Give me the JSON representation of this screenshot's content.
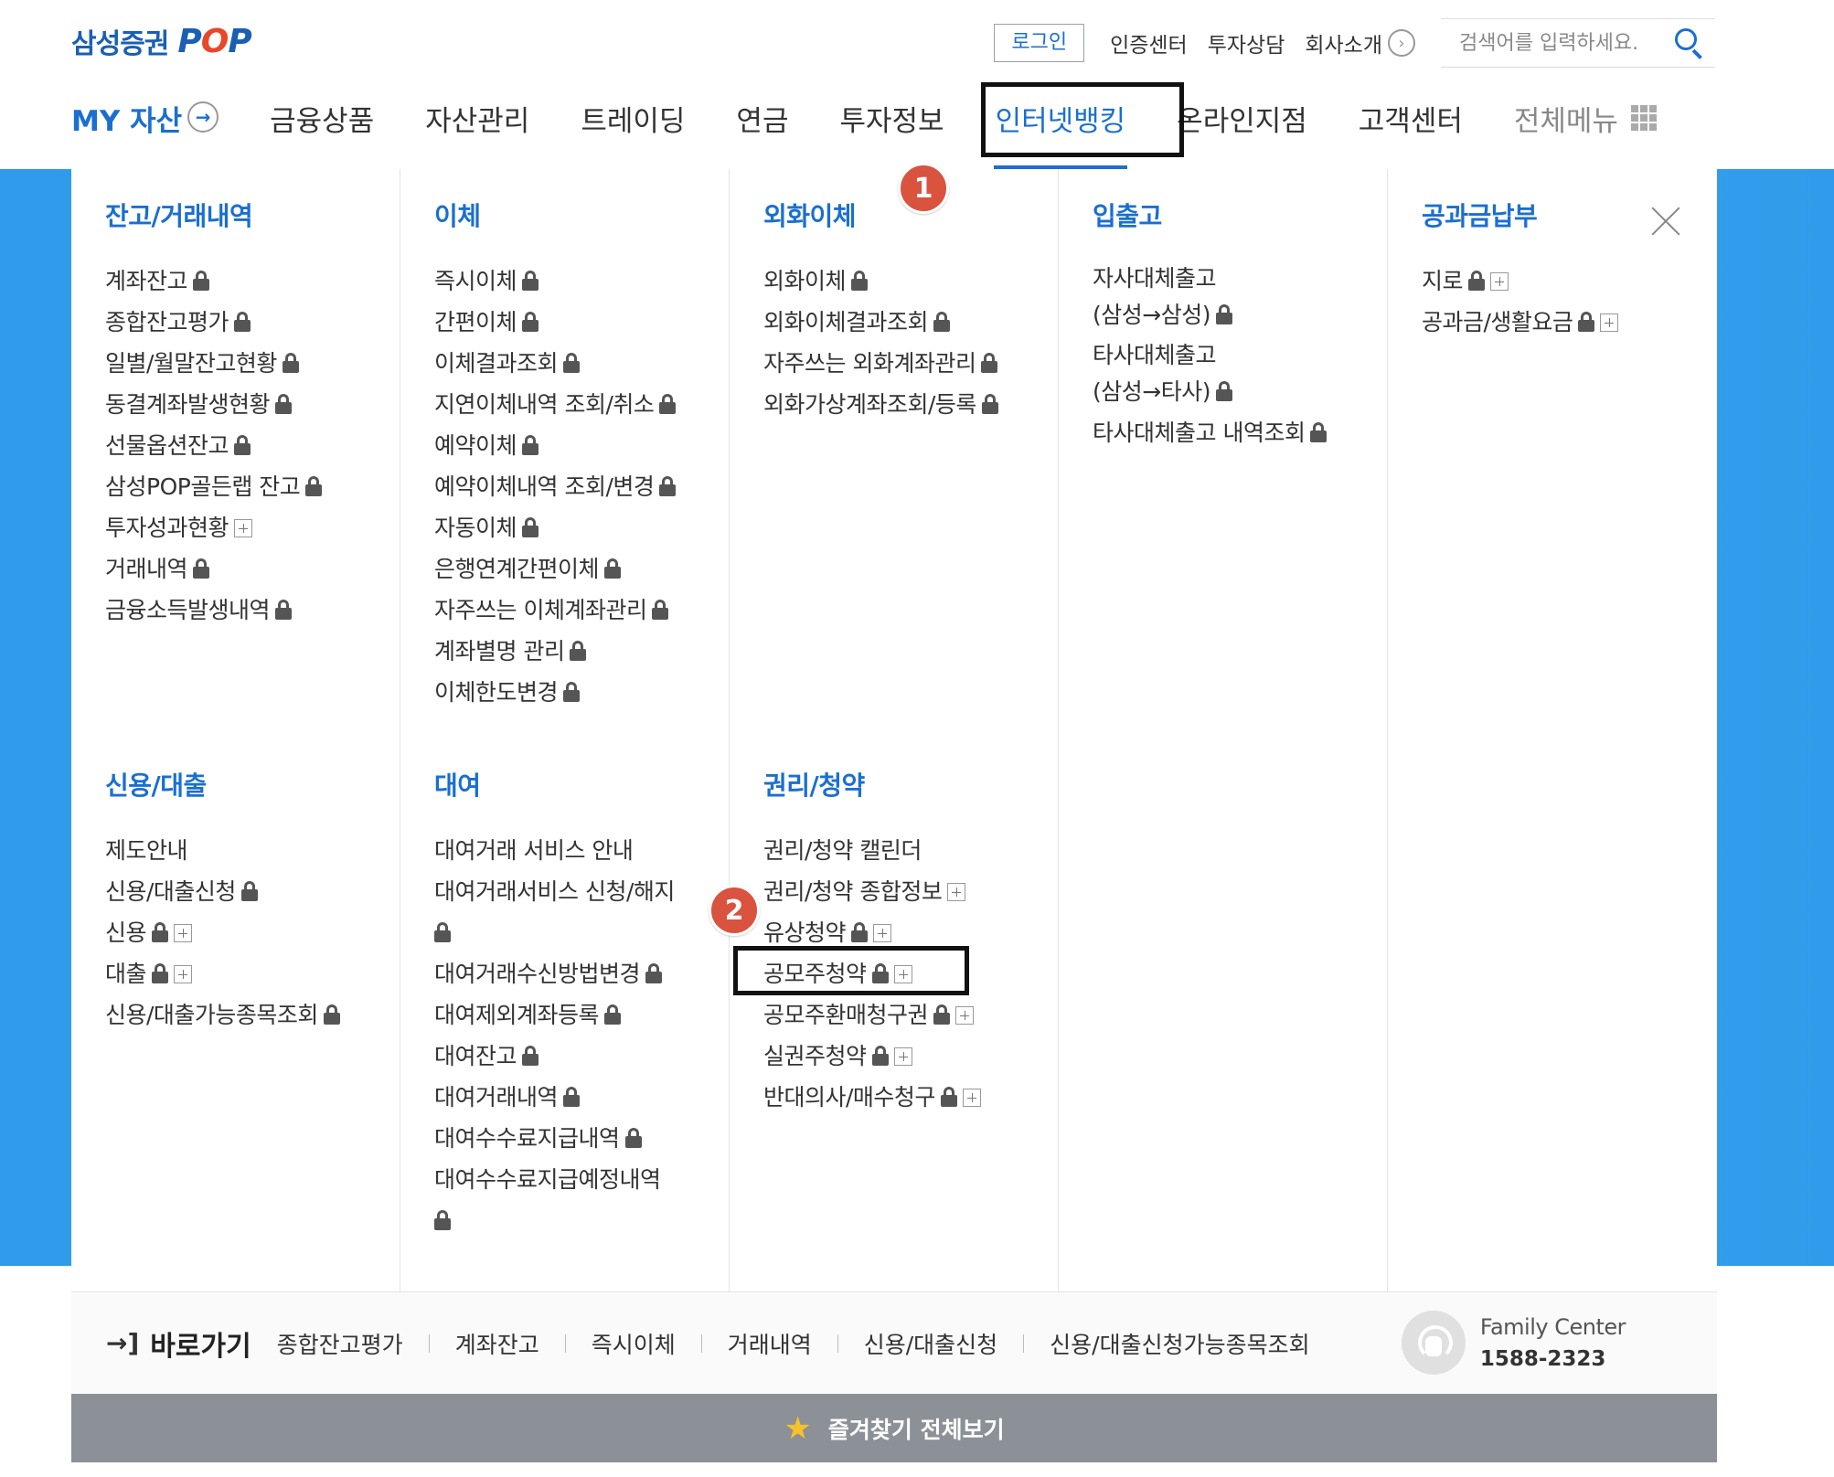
{
  "header": {
    "logo_kr": "삼성증권",
    "logo_pop": "POP",
    "login": "로그인",
    "util_links": [
      "인증센터",
      "투자상담",
      "회사소개"
    ],
    "search_placeholder": "검색어를 입력하세요."
  },
  "nav": {
    "my": "MY 자산",
    "items": [
      "금융상품",
      "자산관리",
      "트레이딩",
      "연금",
      "투자정보",
      "인터넷뱅킹",
      "온라인지점",
      "고객센터"
    ],
    "all": "전체메뉴"
  },
  "badges": {
    "first": "1",
    "second": "2"
  },
  "menu": {
    "col1": {
      "g1": {
        "title": "잔고/거래내역",
        "items": [
          "계좌잔고",
          "종합잔고평가",
          "일별/월말잔고현황",
          "동결계좌발생현황",
          "선물옵션잔고",
          "삼성POP골든랩 잔고",
          "투자성과현황",
          "거래내역",
          "금융소득발생내역"
        ]
      },
      "g2": {
        "title": "신용/대출",
        "items": [
          "제도안내",
          "신용/대출신청",
          "신용",
          "대출",
          "신용/대출가능종목조회"
        ]
      }
    },
    "col2": {
      "g1": {
        "title": "이체",
        "items": [
          "즉시이체",
          "간편이체",
          "이체결과조회",
          "지연이체내역 조회/취소",
          "예약이체",
          "예약이체내역 조회/변경",
          "자동이체",
          "은행연계간편이체",
          "자주쓰는 이체계좌관리",
          "계좌별명 관리",
          "이체한도변경"
        ]
      },
      "g2": {
        "title": "대여",
        "items": [
          "대여거래 서비스 안내",
          "대여거래서비스 신청/해지",
          "대여거래수신방법변경",
          "대여제외계좌등록",
          "대여잔고",
          "대여거래내역",
          "대여수수료지급내역",
          "대여수수료지급예정내역"
        ]
      }
    },
    "col3": {
      "g1": {
        "title": "외화이체",
        "items": [
          "외화이체",
          "외화이체결과조회",
          "자주쓰는 외화계좌관리",
          "외화가상계좌조회/등록"
        ]
      },
      "g2": {
        "title": "권리/청약",
        "items": [
          "권리/청약 캘린더",
          "권리/청약 종합정보",
          "유상청약",
          "공모주청약",
          "공모주환매청구권",
          "실권주청약",
          "반대의사/매수청구"
        ]
      }
    },
    "col4": {
      "g1": {
        "title": "입출고",
        "items": [
          "자사대체출고",
          "(삼성→삼성)",
          "타사대체출고",
          "(삼성→타사)",
          "타사대체출고 내역조회"
        ]
      }
    },
    "col5": {
      "g1": {
        "title": "공과금납부",
        "items": [
          "지로",
          "공과금/생활요금"
        ]
      }
    }
  },
  "quick": {
    "title": "바로가기",
    "links": [
      "종합잔고평가",
      "계좌잔고",
      "즉시이체",
      "거래내역",
      "신용/대출신청",
      "신용/대출신청가능종목조회"
    ]
  },
  "family": {
    "name": "Family Center",
    "phone": "1588-2323"
  },
  "favorites": "즐겨찾기 전체보기",
  "colors": {
    "accent": "#1a6fd0",
    "band": "#2f9bea",
    "badge": "#d9533f",
    "fav_bar": "#8c9097"
  }
}
